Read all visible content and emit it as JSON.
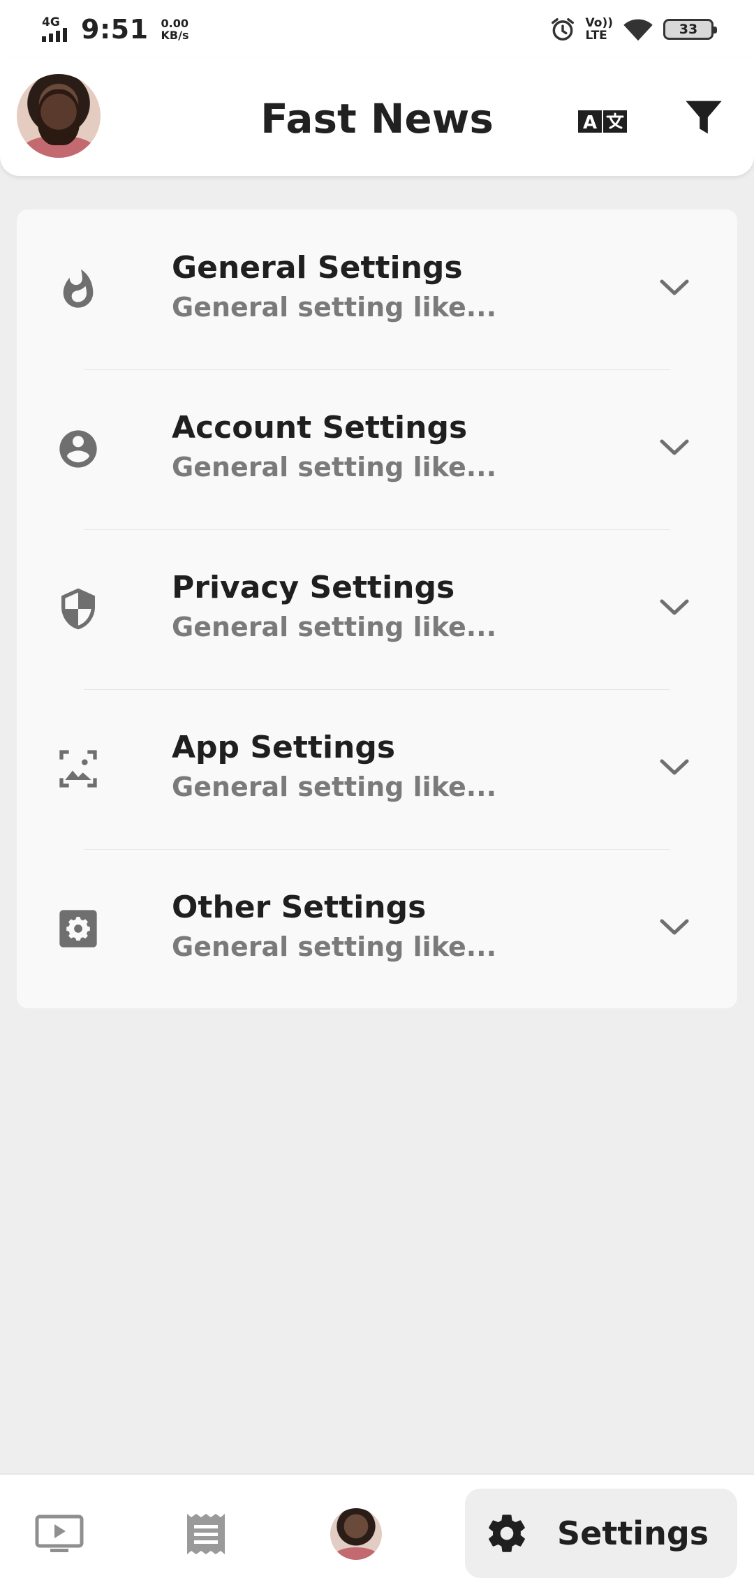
{
  "status_bar": {
    "network": "4G",
    "time": "9:51",
    "speed_value": "0.00",
    "speed_unit": "KB/s",
    "volte_top": "Vo))",
    "volte_bottom": "LTE",
    "battery": "33"
  },
  "app_bar": {
    "title": "Fast News",
    "icons": [
      "avatar",
      "translate-icon",
      "filter-icon"
    ]
  },
  "settings": {
    "items": [
      {
        "title": "General Settings",
        "subtitle": "General setting like...",
        "icon": "fire-icon"
      },
      {
        "title": "Account Settings",
        "subtitle": "General setting like...",
        "icon": "account-circle-icon"
      },
      {
        "title": "Privacy Settings",
        "subtitle": "General setting like...",
        "icon": "shield-icon"
      },
      {
        "title": "App Settings",
        "subtitle": "General setting like...",
        "icon": "image-frame-icon"
      },
      {
        "title": "Other Settings",
        "subtitle": "General setting like...",
        "icon": "gear-box-icon"
      }
    ]
  },
  "bottom_nav": {
    "items": [
      "video-icon",
      "list-icon",
      "profile-avatar",
      "settings"
    ],
    "active_label": "Settings"
  },
  "colors": {
    "background": "#eeeeee",
    "card": "#f9f9f9",
    "title": "#1f1f1f",
    "subtitle": "#7a7a7a",
    "icon_gray": "#6f6f6f"
  }
}
